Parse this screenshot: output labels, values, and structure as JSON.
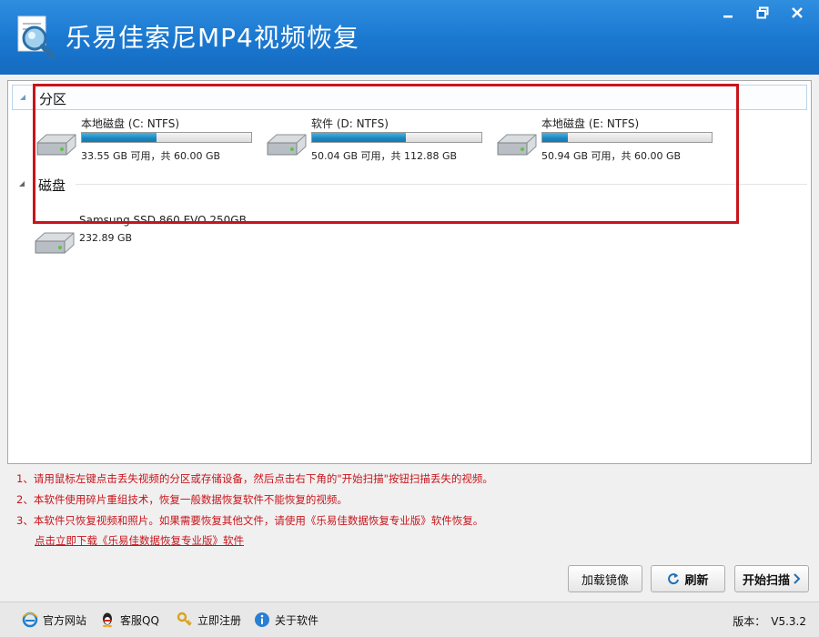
{
  "window": {
    "title": "乐易佳索尼MP4视频恢复",
    "icons": [
      "app-logo-icon",
      "minimize-icon",
      "restore-icon",
      "close-icon"
    ]
  },
  "partitions": {
    "label": "分区",
    "items": [
      {
        "name": "本地磁盘 (C: NTFS)",
        "info": "33.55 GB 可用，共 60.00 GB",
        "used_fraction": 0.44
      },
      {
        "name": "软件 (D: NTFS)",
        "info": "50.04 GB 可用，共 112.88 GB",
        "used_fraction": 0.556
      },
      {
        "name": "本地磁盘 (E: NTFS)",
        "info": "50.94 GB 可用，共 60.00 GB",
        "used_fraction": 0.151
      }
    ]
  },
  "disks": {
    "label": "磁盘",
    "items": [
      {
        "name": "Samsung SSD 860 EVO 250GB",
        "info": "232.89 GB"
      }
    ]
  },
  "notes": [
    "1、请用鼠标左键点击丢失视频的分区或存储设备，然后点击右下角的\"开始扫描\"按钮扫描丢失的视频。",
    "2、本软件使用碎片重组技术，恢复一般数据恢复软件不能恢复的视频。",
    "3、本软件只恢复视频和照片。如果需要恢复其他文件，请使用《乐易佳数据恢复专业版》软件恢复。"
  ],
  "download_link": "点击立即下载《乐易佳数据恢复专业版》软件",
  "buttons": {
    "load_image": "加载镜像",
    "refresh": "刷新",
    "start_scan": "开始扫描"
  },
  "statusbar": {
    "website": "官方网站",
    "qq": "客服QQ",
    "register": "立即注册",
    "about": "关于软件",
    "version_label": "版本：",
    "version_value": "V5.3.2"
  },
  "colors": {
    "title_bar": "#1a77cf",
    "note_text": "#c8141b",
    "highlight_box": "#c8141b",
    "usage_bar": "#1a86c0"
  }
}
